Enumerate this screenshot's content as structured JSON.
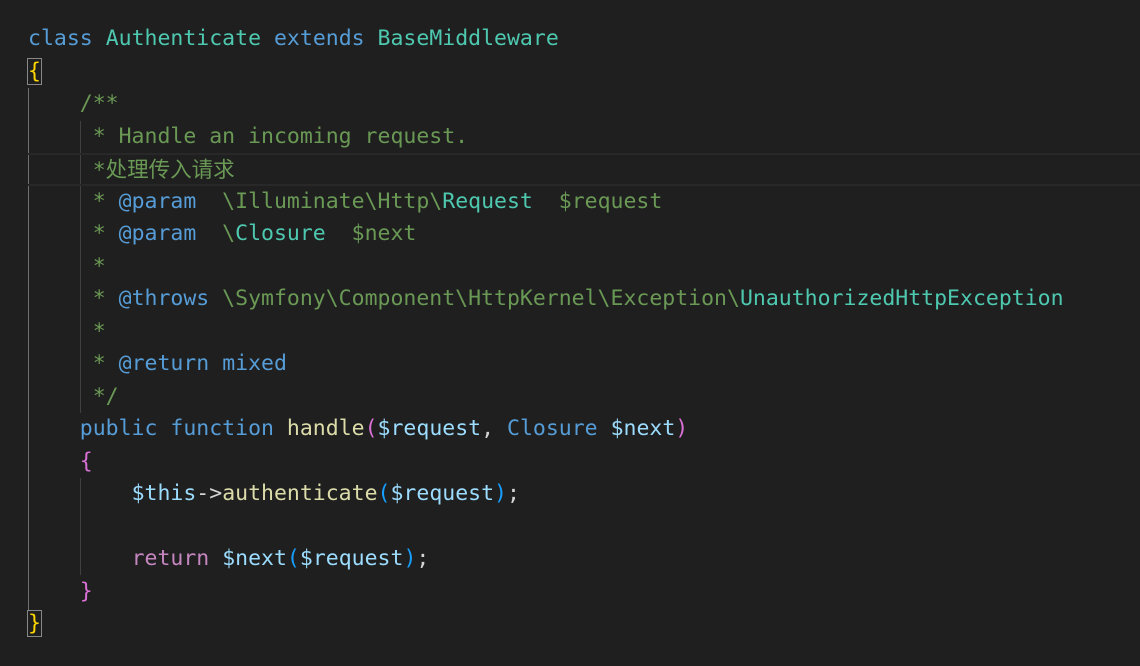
{
  "theme": {
    "background": "#1f1f1f",
    "keyword": "#569cd6",
    "class_name": "#4ec9b0",
    "function_name": "#dcdcaa",
    "variable": "#9cdcfe",
    "comment": "#6a9955",
    "control_keyword": "#c586c0",
    "text": "#d4d4d4",
    "bracket_level1": "#ffd700",
    "bracket_level2": "#da70d6",
    "bracket_level3": "#179fff"
  },
  "code": {
    "line1": {
      "kw_class": "class",
      "cls_name": "Authenticate",
      "kw_extends": "extends",
      "parent": "BaseMiddleware"
    },
    "line2": {
      "brace_open": "{"
    },
    "line3": {
      "text": "/**"
    },
    "line4": {
      "text": " * Handle an incoming request."
    },
    "line5": {
      "text": " *处理传入请求"
    },
    "line6": {
      "star": " * ",
      "tag": "@param",
      "ns": "  \\Illuminate\\Http\\",
      "cls": "Request",
      "var": "  $request"
    },
    "line7": {
      "star": " * ",
      "tag": "@param",
      "ns": "  \\",
      "cls": "Closure",
      "var": "  $next"
    },
    "line8": {
      "text": " *"
    },
    "line9": {
      "star": " * ",
      "tag": "@throws",
      "ns": " \\Symfony\\Component\\HttpKernel\\Exception\\",
      "cls": "UnauthorizedHttpException"
    },
    "line10": {
      "text": " *"
    },
    "line11": {
      "star": " * ",
      "tag": "@return",
      "type": "mixed"
    },
    "line12": {
      "text": " */"
    },
    "line13": {
      "kw_public": "public",
      "kw_function": "function",
      "fn": "handle",
      "paren_open": "(",
      "param1": "$request",
      "comma": ", ",
      "type": "Closure",
      "param2": "$next",
      "paren_close": ")"
    },
    "line14": {
      "brace_open": "{"
    },
    "line15": {
      "this": "$this",
      "arrow": "->",
      "method": "authenticate",
      "paren_open": "(",
      "arg": "$request",
      "paren_close": ")",
      "semi": ";"
    },
    "line17": {
      "kw_return": "return",
      "callee": "$next",
      "paren_open": "(",
      "arg": "$request",
      "paren_close": ")",
      "semi": ";"
    },
    "line18": {
      "brace_close": "}"
    },
    "line19": {
      "brace_close": "}"
    }
  }
}
